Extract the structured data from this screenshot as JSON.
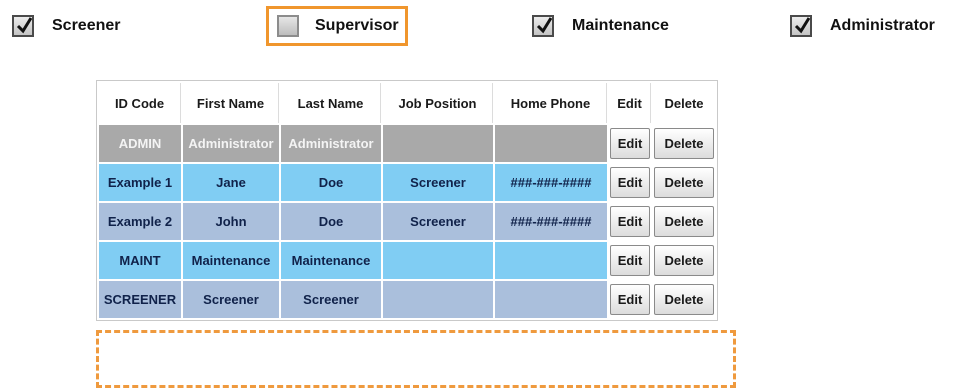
{
  "role_filters": [
    {
      "label": "Screener",
      "checked": true
    },
    {
      "label": "Supervisor",
      "checked": false
    },
    {
      "label": "Maintenance",
      "checked": true
    },
    {
      "label": "Administrator",
      "checked": true
    }
  ],
  "highlight_color": "#f0962d",
  "table": {
    "headers": [
      "ID Code",
      "First Name",
      "Last Name",
      "Job Position",
      "Home Phone",
      "Edit",
      "Delete"
    ],
    "edit_label": "Edit",
    "delete_label": "Delete",
    "rows": [
      {
        "id": "ADMIN",
        "first": "Administrator",
        "last": "Administrator",
        "job": "",
        "phone": "",
        "color": "#a9a9a9"
      },
      {
        "id": "Example 1",
        "first": "Jane",
        "last": "Doe",
        "job": "Screener",
        "phone": "###-###-####",
        "color": "#80cdf3"
      },
      {
        "id": "Example 2",
        "first": "John",
        "last": "Doe",
        "job": "Screener",
        "phone": "###-###-####",
        "color": "#aabfdc"
      },
      {
        "id": "MAINT",
        "first": "Maintenance",
        "last": "Maintenance",
        "job": "",
        "phone": "",
        "color": "#80cdf3"
      },
      {
        "id": "SCREENER",
        "first": "Screener",
        "last": "Screener",
        "job": "",
        "phone": "",
        "color": "#aabfdc"
      }
    ]
  }
}
